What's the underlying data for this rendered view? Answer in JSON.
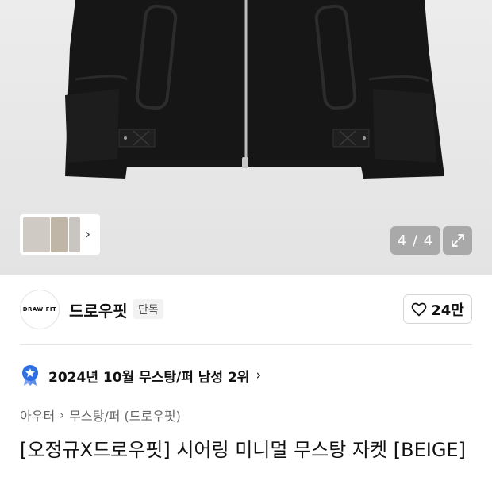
{
  "gallery": {
    "counter": "4 / 4",
    "thumb_chevron": "›"
  },
  "brand": {
    "logo_text": "DRAW FIT",
    "name": "드로우핏",
    "badge": "단독"
  },
  "like": {
    "count": "24만",
    "icon": "heart-icon"
  },
  "ranking": {
    "text": "2024년 10월 무스탕/퍼 남성 2위",
    "arrow": "›",
    "icon": "ranking-badge-icon",
    "badge_color": "#2f6fe4"
  },
  "breadcrumb": {
    "category": "아우터",
    "separator": "›",
    "subcategory": "무스탕/퍼 (드로우핏)"
  },
  "product": {
    "title": "[오정규X드로우핏] 시어링 미니멀 무스탕 자켓 [BEIGE]"
  }
}
